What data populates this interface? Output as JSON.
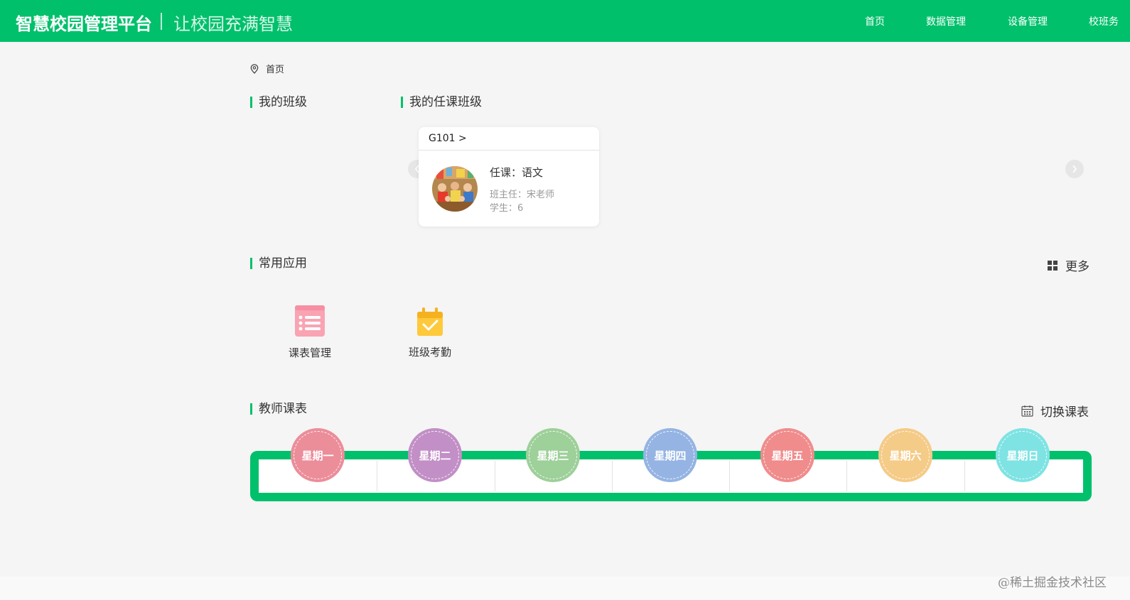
{
  "header": {
    "title": "智慧校园管理平台",
    "slogan": "让校园充满智慧",
    "nav": [
      "首页",
      "数据管理",
      "设备管理",
      "校班务"
    ]
  },
  "breadcrumb": {
    "current": "首页",
    "icon": "location-pin-icon"
  },
  "sections": {
    "my_class": "我的班级",
    "my_teaching_class": "我的任课班级",
    "common_apps": "常用应用",
    "teacher_timetable": "教师课表"
  },
  "class_card": {
    "name": "G101 >",
    "course": "任课：语文",
    "head_teacher": "班主任：宋老师",
    "students": "学生：6"
  },
  "carousel": {
    "prev_icon": "chevron-left-icon",
    "next_icon": "chevron-right-icon"
  },
  "more": {
    "label": "更多",
    "icon": "grid-icon"
  },
  "apps": [
    {
      "label": "课表管理",
      "icon": "schedule-list-icon",
      "color": "#f9a3b3"
    },
    {
      "label": "班级考勤",
      "icon": "calendar-check-icon",
      "color": "#ffc93c"
    }
  ],
  "switch_timetable": {
    "label": "切换课表",
    "icon": "calendar-icon"
  },
  "weekdays": [
    {
      "label": "星期一",
      "color": "#ec8d9a"
    },
    {
      "label": "星期二",
      "color": "#c28fc6"
    },
    {
      "label": "星期三",
      "color": "#9ed09a"
    },
    {
      "label": "星期四",
      "color": "#95b4e3"
    },
    {
      "label": "星期五",
      "color": "#f08c8c"
    },
    {
      "label": "星期六",
      "color": "#f5cb88"
    },
    {
      "label": "星期日",
      "color": "#7fe3e3"
    }
  ],
  "theme": {
    "accent": "#00c06b"
  },
  "watermark": "@稀土掘金技术社区"
}
